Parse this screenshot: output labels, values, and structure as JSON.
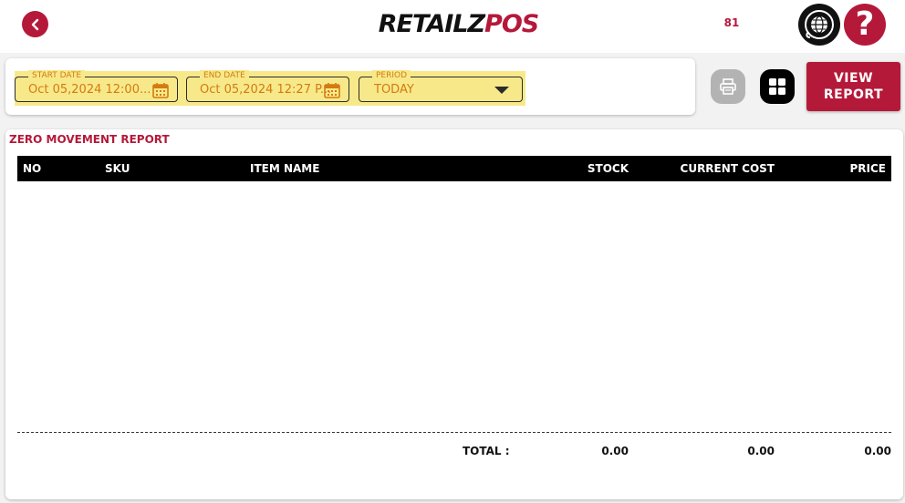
{
  "header": {
    "logo_part1": "RETAILZ",
    "logo_part2": "POS",
    "counter": "81",
    "help_symbol": "?"
  },
  "filters": {
    "start_date": {
      "label": "START DATE",
      "value": "Oct 05,2024 12:00..."
    },
    "end_date": {
      "label": "END DATE",
      "value": "Oct 05,2024 12:27 P..."
    },
    "period": {
      "label": "PERIOD",
      "value": "TODAY"
    }
  },
  "actions": {
    "view_report_line1": "VIEW",
    "view_report_line2": "REPORT"
  },
  "report": {
    "title": "ZERO MOVEMENT REPORT",
    "columns": [
      "NO",
      "SKU",
      "ITEM NAME",
      "STOCK",
      "CURRENT COST",
      "PRICE"
    ],
    "rows": [],
    "totals": {
      "label": "TOTAL :",
      "stock": "0.00",
      "current_cost": "0.00",
      "price": "0.00"
    }
  },
  "colors": {
    "brand": "#b5193a",
    "highlight": "#f7e98a",
    "field_text": "#d47a10"
  },
  "icons": [
    "back-icon",
    "globe-icon",
    "help-icon",
    "calendar-icon",
    "chevron-down-icon",
    "printer-icon",
    "grid-icon"
  ]
}
